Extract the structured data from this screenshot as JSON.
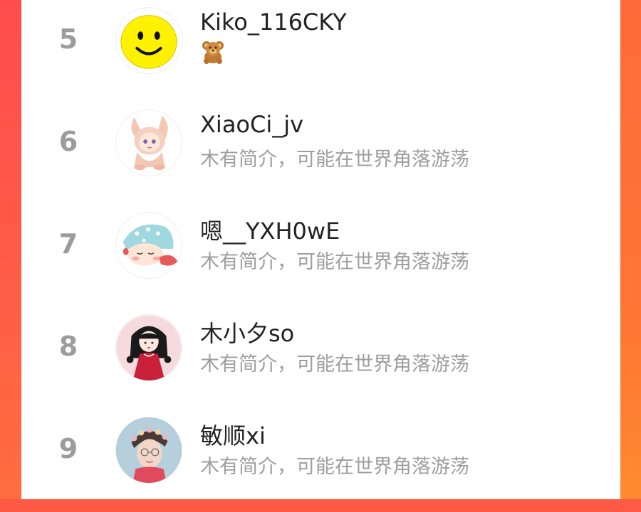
{
  "leaderboard": {
    "rows": [
      {
        "rank": "5",
        "name": "Kiko_116CKY",
        "bio": "",
        "bio_icon": "teddy-bear-icon",
        "avatar": "smiley-face"
      },
      {
        "rank": "6",
        "name": "XiaoCi_jv",
        "bio": "木有简介，可能在世界角落游荡",
        "avatar": "bunny-hood-girl"
      },
      {
        "rank": "7",
        "name": "嗯__YXH0wE",
        "bio": "木有简介，可能在世界角落游荡",
        "avatar": "sleeping-girl-hat"
      },
      {
        "rank": "8",
        "name": "木小夕so",
        "bio": "木有简介，可能在世界角落游荡",
        "avatar": "red-dress-girl"
      },
      {
        "rank": "9",
        "name": "敏顺xi",
        "bio": "木有简介，可能在世界角落游荡",
        "avatar": "boy-flower-crown"
      }
    ]
  },
  "colors": {
    "accent_left": "#ff4d4d",
    "accent_right": "#ff7a33",
    "rank_text": "#9c9c9c",
    "name_text": "#222222",
    "bio_text": "#9e9e9e"
  }
}
